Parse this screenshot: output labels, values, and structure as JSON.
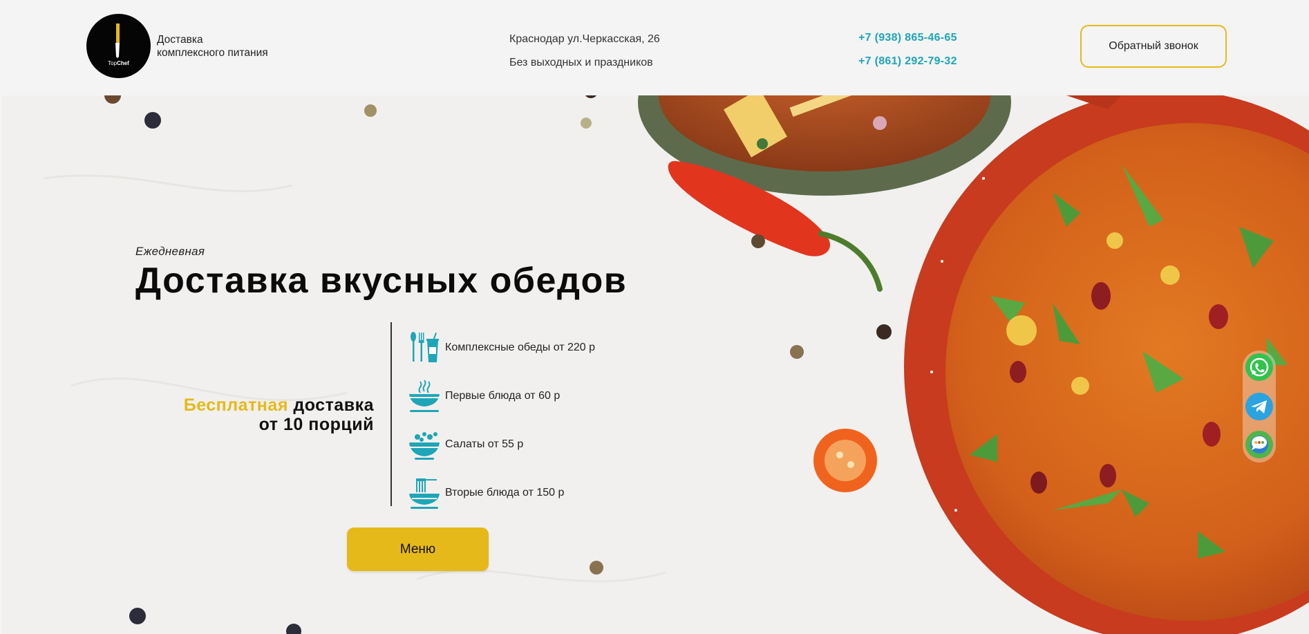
{
  "header": {
    "logo_brand_a": "Top",
    "logo_brand_b": "Chef",
    "tagline_line1": "Доставка",
    "tagline_line2": "комплексного питания",
    "address": "Краснодар ул.Черкасская, 26",
    "schedule": "Без выходных и праздников",
    "phone1": "+7 (938) 865-46-65",
    "phone2": "+7 (861) 292-79-32",
    "callback_label": "Обратный звонок"
  },
  "hero": {
    "subtitle": "Ежедневная",
    "title": "Доставка вкусных обедов",
    "free_accent": "Бесплатная",
    "free_rest": " доставка",
    "free_line2": "от 10 порций",
    "menu_button": "Меню",
    "items": [
      {
        "icon": "cutlery-drink-icon",
        "label": "Комплексные обеды от 220 р"
      },
      {
        "icon": "soup-bowl-icon",
        "label": "Первые блюда от 60 р"
      },
      {
        "icon": "salad-bowl-icon",
        "label": "Салаты от 55 р"
      },
      {
        "icon": "pasta-plate-icon",
        "label": "Вторые блюда от 150 р"
      }
    ]
  },
  "social": [
    "whatsapp-icon",
    "telegram-icon",
    "chat-icon"
  ],
  "colors": {
    "accent": "#e6b91a",
    "teal": "#1ea5b8",
    "soup": "#d96a1c",
    "pot": "#c83b1e"
  }
}
